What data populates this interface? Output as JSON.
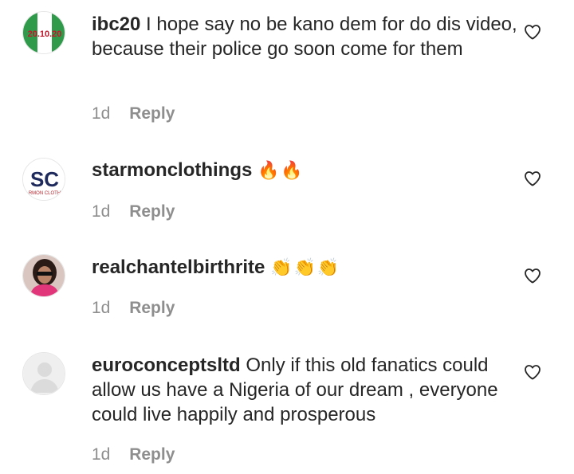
{
  "comments": [
    {
      "username": "ibc20",
      "text": "I hope say no be kano dem for do dis video, because their police go soon come for them",
      "emoji": "",
      "time": "1d",
      "reply_label": "Reply",
      "avatar_text": "20.10.20",
      "avatar_icon": "nigeria-flag-avatar"
    },
    {
      "username": "starmonclothings",
      "text": "",
      "emoji": "🔥🔥",
      "time": "1d",
      "reply_label": "Reply",
      "avatar_text": "SC",
      "avatar_subtext": "RMON CLOTH",
      "avatar_icon": "brand-logo-avatar"
    },
    {
      "username": "realchantelbirthrite",
      "text": "",
      "emoji": "👏👏👏",
      "time": "1d",
      "reply_label": "Reply",
      "avatar_icon": "profile-photo-avatar"
    },
    {
      "username": "euroconceptsltd",
      "text": "Only if this old fanatics could allow us have a Nigeria of our dream , everyone could live happily and prosperous",
      "emoji": "",
      "time": "1d",
      "reply_label": "Reply",
      "avatar_icon": "default-user-avatar"
    }
  ],
  "colors": {
    "text": "#262626",
    "meta": "#8e8e8e",
    "flag_green": "#2e9a4a",
    "flag_red": "#c0192c",
    "brand_navy": "#1f2a5c",
    "brand_red": "#b3262e",
    "placeholder_gray": "#dbdbdb"
  },
  "icons": {
    "like": "heart-outline-icon"
  }
}
